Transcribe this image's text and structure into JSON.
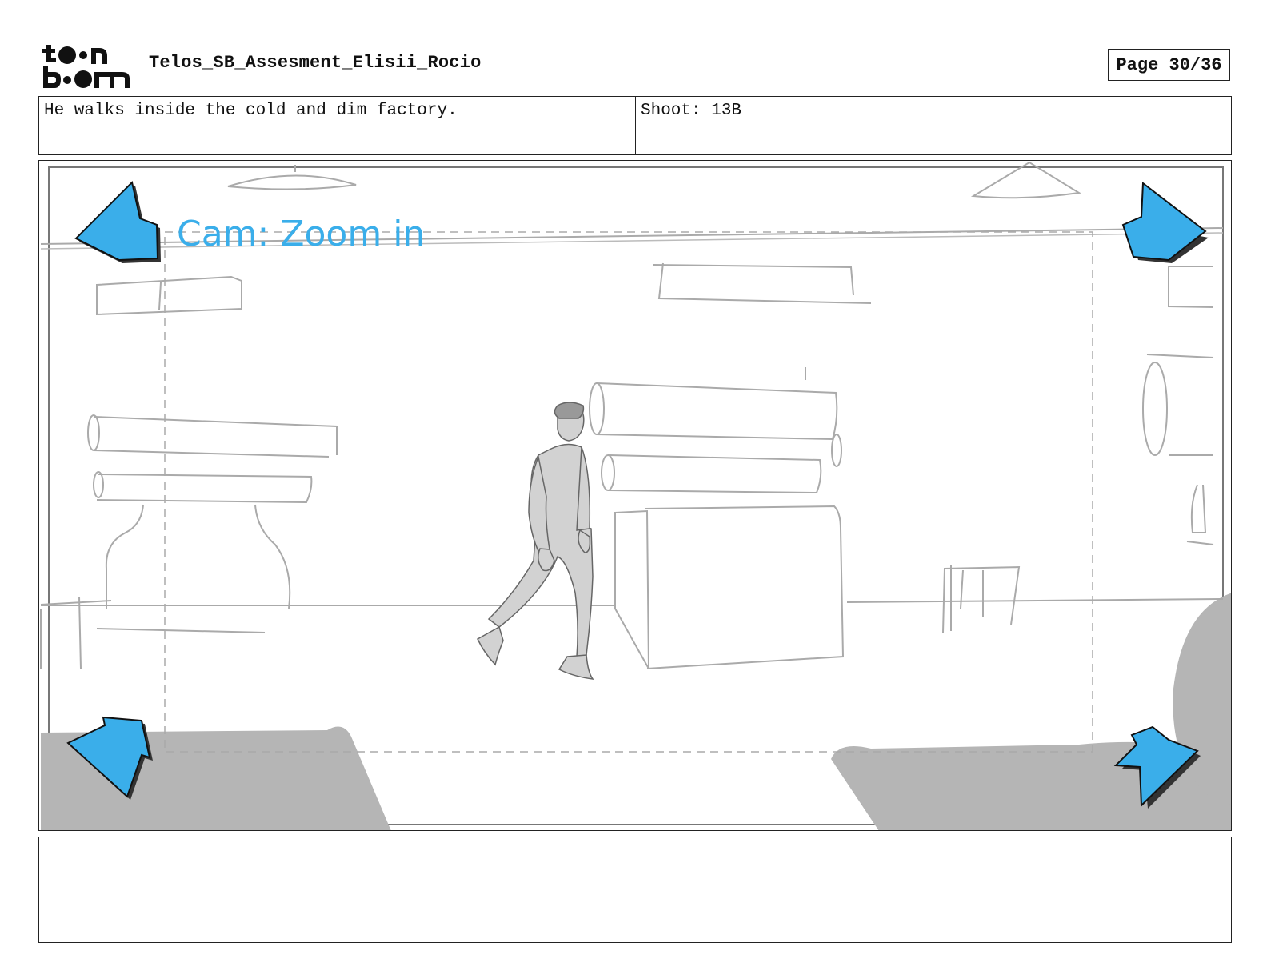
{
  "header": {
    "logo_text": "toon boom",
    "project_title": "Telos_SB_Assesment_Elisii_Rocio",
    "page_label": "Page 30/36"
  },
  "info": {
    "action_text": "He walks inside the cold and dim factory.",
    "shoot_text": "Shoot: 13B"
  },
  "panel": {
    "camera_note": "Cam: Zoom in",
    "arrow_color": "#3aaeea",
    "sketch_color": "#aaaaaa"
  },
  "notes": {
    "text": ""
  }
}
